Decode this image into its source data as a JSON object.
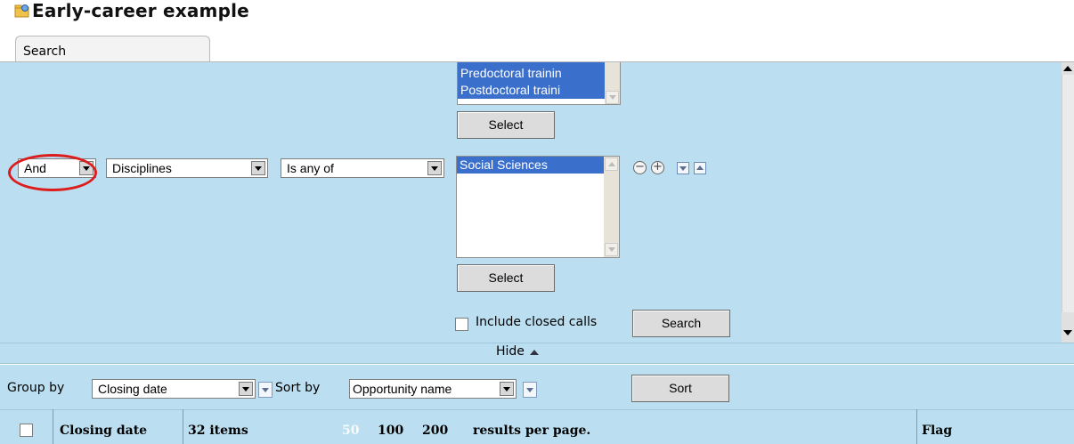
{
  "title": "Early-career example",
  "tabs": [
    {
      "label": "Search"
    }
  ],
  "search": {
    "career_stage_options": [
      "Predoctoral trainin",
      "Postdoctoral traini"
    ],
    "select_label": "Select",
    "criterion": {
      "connector": "And",
      "field": "Disciplines",
      "operator": "Is any of",
      "values": [
        "Social Sciences"
      ],
      "select_label": "Select"
    },
    "include_closed_label": "Include closed calls",
    "include_closed_checked": false,
    "search_button": "Search"
  },
  "hide_label": "Hide",
  "grouping": {
    "group_by_label": "Group by",
    "group_by_value": "Closing date",
    "sort_by_label": "Sort by",
    "sort_by_value": "Opportunity name",
    "sort_button": "Sort"
  },
  "results": {
    "closing_date_header": "Closing date",
    "items_count": "32 items",
    "page_sizes": [
      "50",
      "100",
      "200"
    ],
    "page_sizes_suffix": "results per page.",
    "flag_header": "Flag"
  },
  "colors": {
    "panel_bg": "#bbdff1",
    "selection": "#3a6fcc",
    "highlight": "#dd1c1c"
  }
}
